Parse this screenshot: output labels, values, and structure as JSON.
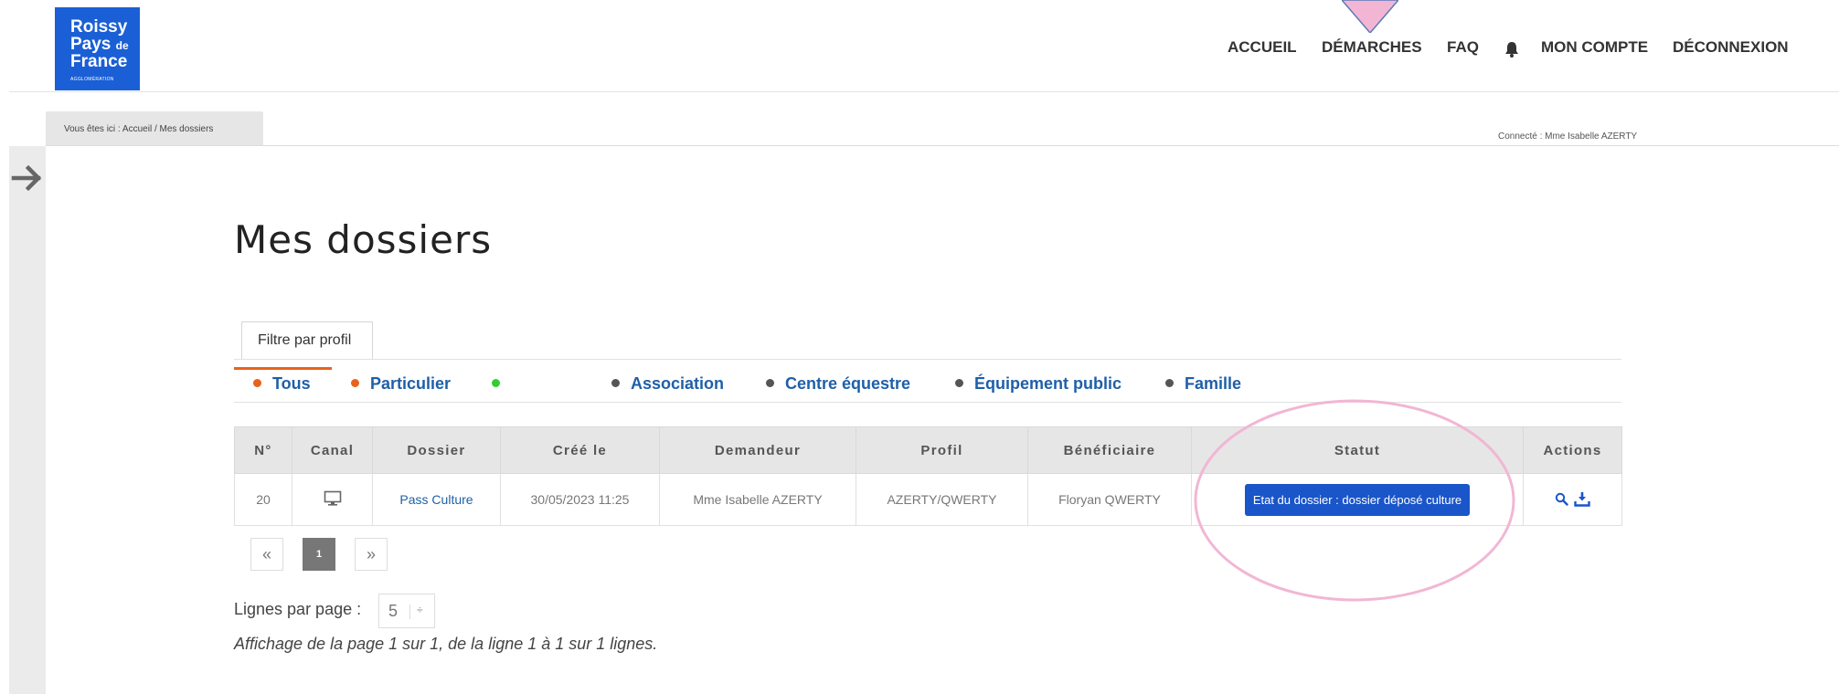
{
  "logo": {
    "line1": "Roissy",
    "line2": "Pays",
    "line2_small": "de",
    "line3": "France",
    "line4": "AGGLOMÉRATION",
    "bg_color": "#1a5fd6"
  },
  "nav": {
    "accueil": "ACCUEIL",
    "demarches": "DÉMARCHES",
    "faq": "FAQ",
    "mon_compte": "MON COMPTE",
    "deconnexion": "DÉCONNEXION",
    "bell_icon": "bell-icon"
  },
  "breadcrumb": {
    "text": "Vous êtes ici :  Accueil  /  Mes dossiers"
  },
  "connected": "Connecté : Mme Isabelle AZERTY",
  "page_title": "Mes dossiers",
  "filter_tab": "Filtre par profil",
  "filters": [
    {
      "label": "Tous",
      "dot_color": "#e8621a"
    },
    {
      "label": "Particulier",
      "dot_color": "#e8621a"
    },
    {
      "label": "",
      "dot_color": "#33cc33"
    },
    {
      "label": "Association",
      "dot_color": "#555555"
    },
    {
      "label": "Centre équestre",
      "dot_color": "#555555"
    },
    {
      "label": "Équipement public",
      "dot_color": "#555555"
    },
    {
      "label": "Famille",
      "dot_color": "#555555"
    }
  ],
  "table": {
    "headers": [
      "N°",
      "Canal",
      "Dossier",
      "Créé le",
      "Demandeur",
      "Profil",
      "Bénéficiaire",
      "Statut",
      "Actions"
    ],
    "rows": [
      {
        "num": "20",
        "canal_icon": "monitor-icon",
        "dossier": "Pass Culture",
        "cree_le": "30/05/2023 11:25",
        "demandeur": "Mme Isabelle AZERTY",
        "profil": "AZERTY/QWERTY",
        "beneficiaire": "Floryan QWERTY",
        "statut": "Etat du dossier : dossier déposé culture",
        "action_icons": [
          "search-icon",
          "download-icon"
        ]
      }
    ]
  },
  "pagination": {
    "prev": "«",
    "page": "1",
    "next": "»"
  },
  "lines_per_page": {
    "label": "Lignes par page :",
    "value": "5",
    "arrow": "÷"
  },
  "info": "Affichage de la page 1 sur 1, de la ligne 1 à 1 sur 1 lignes.",
  "colors": {
    "accent_blue": "#1f5fa8",
    "status_button": "#1a55c9",
    "annotation_pink": "#f2b6d4"
  }
}
